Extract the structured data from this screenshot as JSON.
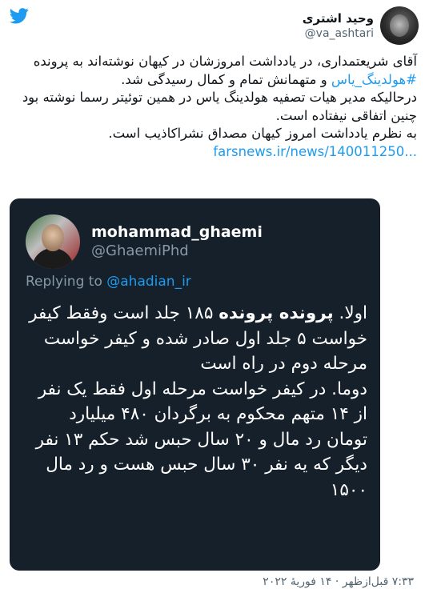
{
  "brand": {
    "logo_icon": "twitter-bird-icon",
    "color": "#1d9bf0"
  },
  "author": {
    "name": "وحید اشتری",
    "handle": "@va_ashtari"
  },
  "tweet": {
    "line1": "آقای شریعتمداری، در یادداشت امروزشان در کیهان نوشته‌اند به پرونده ",
    "hashtag": "#هولدینگ_یاس",
    "line1_end": " و متهمانش تمام و کمال رسیدگی شد.",
    "line2": "درحالیکه مدیر هیات تصفیه هولدینگ یاس در همین توئیتر رسما نوشته بود چنین اتفاقی نیفتاده است.",
    "line3": "به نظرم یادداشت امروز کیهان مصداق نشراکاذیب است.",
    "link": "farsnews.ir/news/140011250..."
  },
  "quoted": {
    "name": "mohammad_ghaemi",
    "handle": "@GhaemiPhd",
    "replying_prefix": "Replying to ",
    "replying_mention": "@ahadian_ir",
    "p1_start": "اولا. ",
    "p1_bold": "پرونده پرونده",
    "p1_rest": " ۱۸۵ جلد است وفقط کیفر خواست ۵ جلد اول صادر شده و کیفر خواست مرحله دوم در راه است",
    "p2": "دوما. در کیفر خواست مرحله اول فقط یک نفر از ۱۴ متهم محکوم به برگردان ۴۸۰ میلیارد تومان رد مال و ۲۰ سال حبس شد حکم ۱۳ نفر دیگر که یه نفر ۳۰ سال حبس هست و رد مال ۱۵۰۰"
  },
  "footer": {
    "timestamp": "۷:۳۳ قبل‌ازظهر · ۱۴ فوریهٔ ۲۰۲۲"
  }
}
